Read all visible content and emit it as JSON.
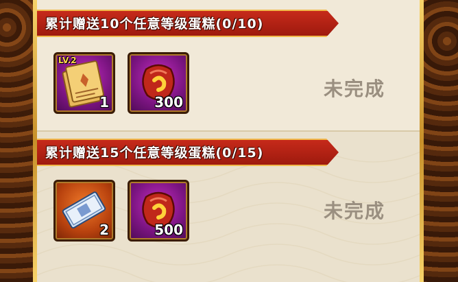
{
  "tasks": [
    {
      "title": "累计赠送10个任意等级蛋糕(0/10)",
      "status": "未完成",
      "rewards": [
        {
          "icon": "scroll-lv2-icon",
          "badge": "LV.2",
          "qty": "1"
        },
        {
          "icon": "red-gem-icon",
          "qty": "300"
        }
      ]
    },
    {
      "title": "累计赠送15个任意等级蛋糕(0/15)",
      "status": "未完成",
      "rewards": [
        {
          "icon": "ticket-icon",
          "qty": "2"
        },
        {
          "icon": "red-gem-icon",
          "qty": "500"
        }
      ]
    }
  ],
  "colors": {
    "banner": "#c62a1a",
    "gold": "#f0b84a",
    "panel": "#efe7d6",
    "status": "#9a8f80"
  }
}
